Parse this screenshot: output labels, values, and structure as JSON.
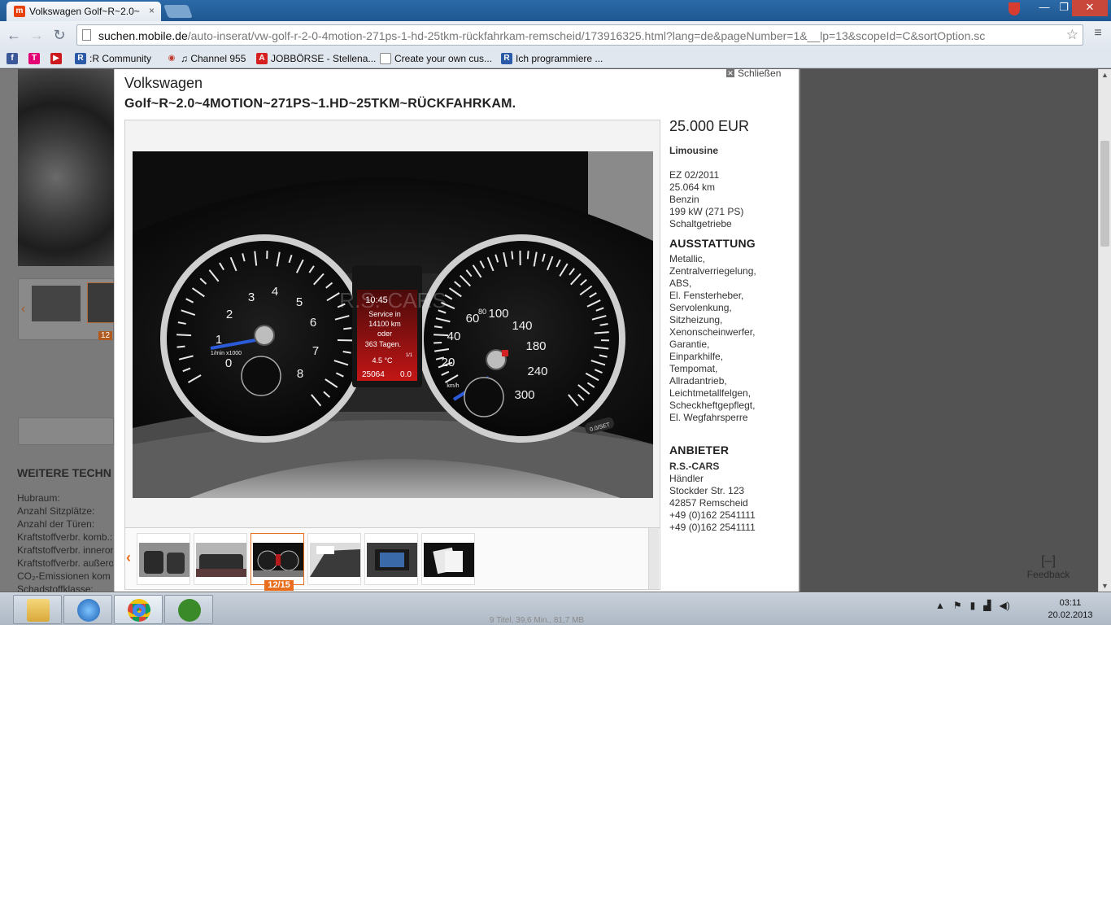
{
  "browser": {
    "tab_title": "Volkswagen Golf~R~2.0~",
    "tab_close": "×",
    "url_host": "suchen.mobile.de",
    "url_path": "/auto-inserat/vw-golf-r-2-0-4motion-271ps-1-hd-25tkm-rückfahrkam-remscheid/173916325.html?lang=de&pageNumber=1&__lp=13&scopeId=C&sortOption.sc",
    "window_min": "—",
    "window_max": "❐",
    "window_close": "✕",
    "star": "☆",
    "menu": "≡",
    "back": "←",
    "forward": "→",
    "reload": "↻"
  },
  "bookmarks": [
    {
      "label": "",
      "icon": "facebook-icon",
      "color": "#3b5998",
      "glyph": "f"
    },
    {
      "label": "",
      "icon": "telekom-icon",
      "color": "#e20074",
      "glyph": "T"
    },
    {
      "label": "",
      "icon": "youtube-icon",
      "color": "#cc181e",
      "glyph": "▶"
    },
    {
      "label": ":R Community",
      "icon": "community-icon",
      "color": "#2b5aa8",
      "glyph": "R"
    },
    {
      "label": "♫ Channel 955",
      "icon": "radio-icon",
      "color": "#c0392b",
      "glyph": "◉"
    },
    {
      "label": "JOBBÖRSE - Stellena...",
      "icon": "jobboerse-icon",
      "color": "#d62020",
      "glyph": "A"
    },
    {
      "label": "Create your own cus...",
      "icon": "document-icon",
      "color": "#ffffff",
      "glyph": ""
    },
    {
      "label": "Ich programmiere ...",
      "icon": "community-icon",
      "color": "#2b5aa8",
      "glyph": "R"
    }
  ],
  "background_page": {
    "thumb_counter": "12",
    "section_heading": "WEITERE TECHN",
    "spec_labels": [
      "Hubraum:",
      "Anzahl Sitzplätze:",
      "Anzahl der Türen:",
      "Kraftstoffverbr. komb.:",
      "Kraftstoffverbr. innerort",
      "Kraftstoffverbr. außerort",
      "CO₂-Emissionen kom",
      "Schadstoffklasse:"
    ],
    "feedback_label": "Feedback"
  },
  "listing": {
    "close_label": "Schließen",
    "make": "Volkswagen",
    "model": "Golf~R~2.0~4MOTION~271PS~1.HD~25TKM~RÜCKFAHRKAM.",
    "price": "25.000 EUR",
    "body_type": "Limousine",
    "specs": [
      "EZ 02/2011",
      "25.064 km",
      "Benzin",
      "199 kW (271 PS)",
      "Schaltgetriebe"
    ],
    "equipment_heading": "AUSSTATTUNG",
    "equipment": [
      "Metallic,",
      "Zentralverriegelung,",
      "ABS,",
      "El. Fensterheber,",
      "Servolenkung,",
      "Sitzheizung,",
      "Xenonscheinwerfer,",
      "Garantie,",
      "Einparkhilfe,",
      "Tempomat,",
      "Allradantrieb,",
      "Leichtmetallfelgen,",
      "Scheckheftgepflegt,",
      "El. Wegfahrsperre"
    ],
    "seller_heading": "ANBIETER",
    "seller_name": "R.S.-CARS",
    "seller_type": "Händler",
    "seller_street": "Stockder Str. 123",
    "seller_city": "42857 Remscheid",
    "seller_phones": [
      "+49 (0)162 2541111",
      "+49 (0)162 2541111"
    ],
    "thumb_counter": "12/15",
    "photo": {
      "watermark": "R.S.-CARS",
      "clock": "10:45",
      "service_line1": "Service in",
      "service_line2": "14100 km",
      "service_line3": "oder",
      "service_line4": "363 Tagen.",
      "temp": "4.5 °C",
      "odo": "25064",
      "trip": "0.0",
      "page": "1/1",
      "rpm_labels": [
        "0",
        "1",
        "2",
        "3",
        "4",
        "5",
        "6",
        "7",
        "8"
      ],
      "speed_labels": [
        "20",
        "40",
        "60",
        "80",
        "100",
        "140",
        "180",
        "240",
        "300"
      ],
      "rpm_unit": "1/min x1000",
      "speed_unit": "km/h",
      "reset_label": "0.0/SET"
    }
  },
  "taskbar": {
    "clock_time": "03:11",
    "clock_date": "20.02.2013",
    "spotify_status": "9 Titel, 39,6 Min., 81,7 MB",
    "tray_arrow": "▲"
  }
}
